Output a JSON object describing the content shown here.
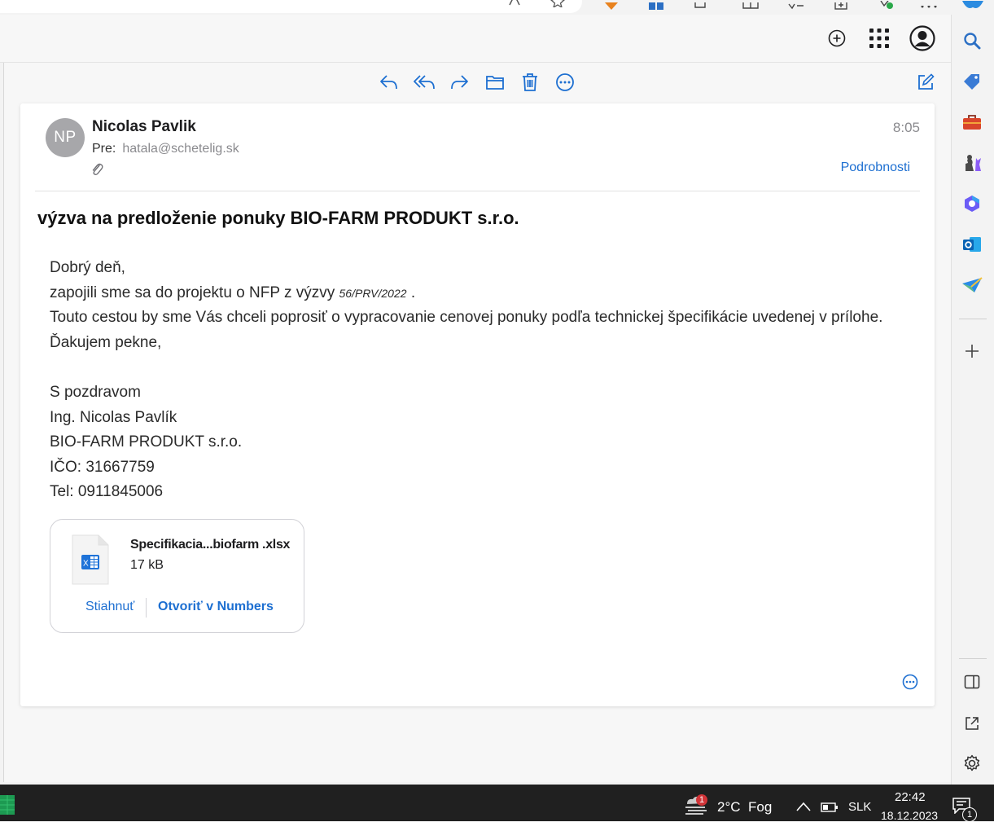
{
  "colors": {
    "accent": "#1d6fd1",
    "avatar_bg": "#a7a7aa",
    "taskbar": "#202020"
  },
  "header": {
    "icons": [
      "add-circle-icon",
      "apps-grid-icon",
      "account-icon"
    ]
  },
  "toolbar": {
    "icons": [
      "reply-icon",
      "reply-all-icon",
      "forward-icon",
      "move-folder-icon",
      "trash-icon",
      "more-icon",
      "compose-icon"
    ]
  },
  "message": {
    "avatar_initials": "NP",
    "sender": "Nicolas Pavlik",
    "to_label": "Pre:",
    "to_address": "hatala@schetelig.sk",
    "time": "8:05",
    "details_label": "Podrobnosti",
    "subject": "výzva na predloženie ponuky BIO-FARM PRODUKT s.r.o.",
    "body": {
      "line1": "Dobrý deň,",
      "line2_prefix": "zapojili sme sa do projektu o NFP z výzvy ",
      "line2_call": "56/PRV/2022",
      "line2_suffix": " .",
      "line3": "Touto cestou by sme Vás chceli poprosiť o vypracovanie cenovej ponuky podľa technickej špecifikácie uvedenej v prílohe.",
      "line4": "Ďakujem pekne,",
      "line6": "S pozdravom",
      "line7": "Ing. Nicolas Pavlík",
      "line8": "BIO-FARM PRODUKT s.r.o.",
      "line9": "IČO: 31667759",
      "line10": "Tel: 0911845006"
    },
    "attachment": {
      "name": "Specifikacia...biofarm .xlsx",
      "size": "17 kB",
      "download_label": "Stiahnuť",
      "open_label": "Otvoriť v Numbers"
    }
  },
  "edge_sidebar": {
    "icons": [
      "search-icon",
      "shopping-tag-icon",
      "tools-briefcase-icon",
      "games-icon",
      "copilot-icon",
      "outlook-icon",
      "send-icon",
      "add-icon",
      "split-screen-icon",
      "external-link-icon",
      "settings-gear-icon"
    ]
  },
  "taskbar": {
    "weather_badge": "1",
    "temperature": "2°C",
    "weather": "Fog",
    "language": "SLK",
    "time": "22:42",
    "date": "18.12.2023",
    "notification_count": "1"
  }
}
